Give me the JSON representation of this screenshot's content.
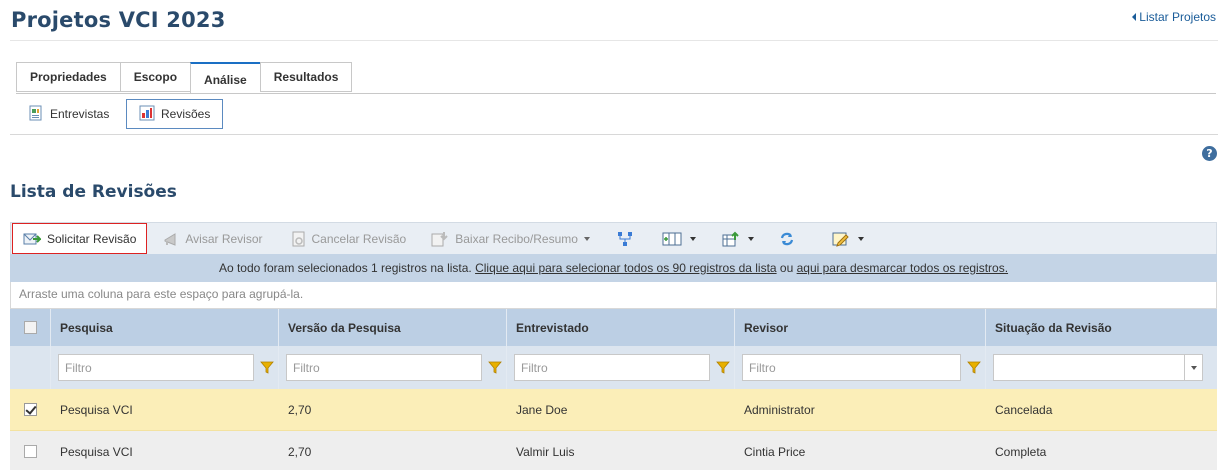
{
  "page": {
    "title": "Projetos VCI 2023",
    "back_link": "Listar Projetos"
  },
  "tabs": [
    {
      "label": "Propriedades",
      "active": false
    },
    {
      "label": "Escopo",
      "active": false
    },
    {
      "label": "Análise",
      "active": true
    },
    {
      "label": "Resultados",
      "active": false
    }
  ],
  "subtabs": [
    {
      "label": "Entrevistas",
      "active": false,
      "icon": "document-icon"
    },
    {
      "label": "Revisões",
      "active": true,
      "icon": "chart-icon"
    }
  ],
  "section": {
    "title": "Lista de Revisões"
  },
  "toolbar": {
    "request_review": "Solicitar Revisão",
    "notify_reviewer": "Avisar Revisor",
    "cancel_review": "Cancelar Revisão",
    "download_receipt": "Baixar Recibo/Resumo"
  },
  "notice": {
    "text_before": "Ao todo foram selecionados 1 registros na lista. ",
    "link_select_all": "Clique aqui para selecionar todos os 90 registros da lista",
    "text_middle": " ou ",
    "link_deselect_all": "aqui para desmarcar todos os registros."
  },
  "group_hint": "Arraste uma coluna para este espaço para agrupá-la.",
  "grid": {
    "columns": [
      "Pesquisa",
      "Versão da Pesquisa",
      "Entrevistado",
      "Revisor",
      "Situação da Revisão"
    ],
    "filter_placeholder": "Filtro",
    "rows": [
      {
        "selected": true,
        "cells": [
          "Pesquisa VCI",
          "2,70",
          "Jane Doe",
          "Administrator",
          "Cancelada"
        ]
      },
      {
        "selected": false,
        "cells": [
          "Pesquisa VCI",
          "2,70",
          "Valmir Luis",
          "Cintia Price",
          "Completa"
        ]
      }
    ]
  },
  "colors": {
    "title": "#2a4a6b",
    "accent": "#1a6fc4",
    "header": "#bccfe4",
    "selected_row": "#fbeeb8",
    "highlight_border": "#dd2222"
  }
}
